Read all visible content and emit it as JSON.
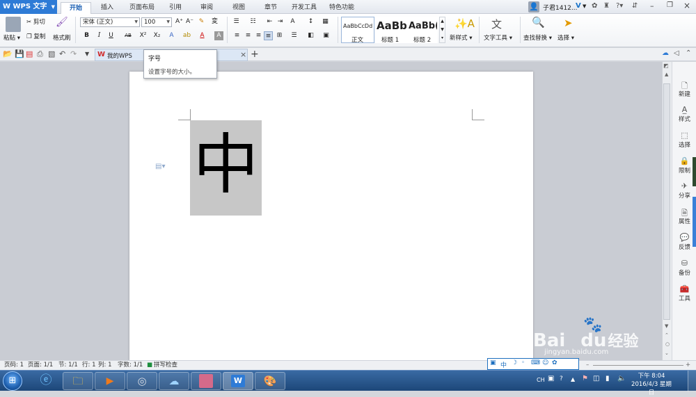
{
  "app": {
    "name": "WPS 文字"
  },
  "menu_tabs": [
    "开始",
    "插入",
    "页面布局",
    "引用",
    "审阅",
    "视图",
    "章节",
    "开发工具",
    "特色功能"
  ],
  "active_tab": "开始",
  "user": {
    "name": "子君1412...",
    "vip": "V"
  },
  "ribbon": {
    "paste": "粘贴",
    "cut": "剪切",
    "copy": "复制",
    "format_painter": "格式刷",
    "font_name": "宋体 (正文)",
    "font_size": "100",
    "styles": [
      {
        "preview": "AaBbCcDd",
        "label": "正文"
      },
      {
        "preview": "AaBb",
        "label": "标题 1"
      },
      {
        "preview": "AaBb(",
        "label": "标题 2"
      }
    ],
    "new_style": "新样式",
    "text_tools": "文字工具",
    "find_replace": "查找替换",
    "select": "选择"
  },
  "doc_tab": {
    "label": "我的WPS"
  },
  "tooltip": {
    "title": "字号",
    "description": "设置字号的大小。"
  },
  "document": {
    "character": "中"
  },
  "side_panel": [
    "新建",
    "样式",
    "选择",
    "限制",
    "分享",
    "属性",
    "反馈",
    "备份",
    "工具"
  ],
  "status": {
    "page_num": "页码: 1",
    "pages": "页面: 1/1",
    "section": "节: 1/1",
    "row": "行: 1",
    "col": "列: 1",
    "words": "字数: 1/1",
    "spell": "拼写检查"
  },
  "ime": {
    "lang": "中"
  },
  "tray": {
    "lang": "CH"
  },
  "clock": {
    "time": "下午 8:04",
    "date": "2016/4/3 星期日"
  },
  "watermark": {
    "brand": "Bai",
    "brand2": "du",
    "brand3": "经验",
    "url": "jingyan.baidu.com"
  },
  "colors": {
    "accent": "#2e7bd6",
    "taskbar": "#1d4779",
    "highlight": "#c7c7c7"
  }
}
